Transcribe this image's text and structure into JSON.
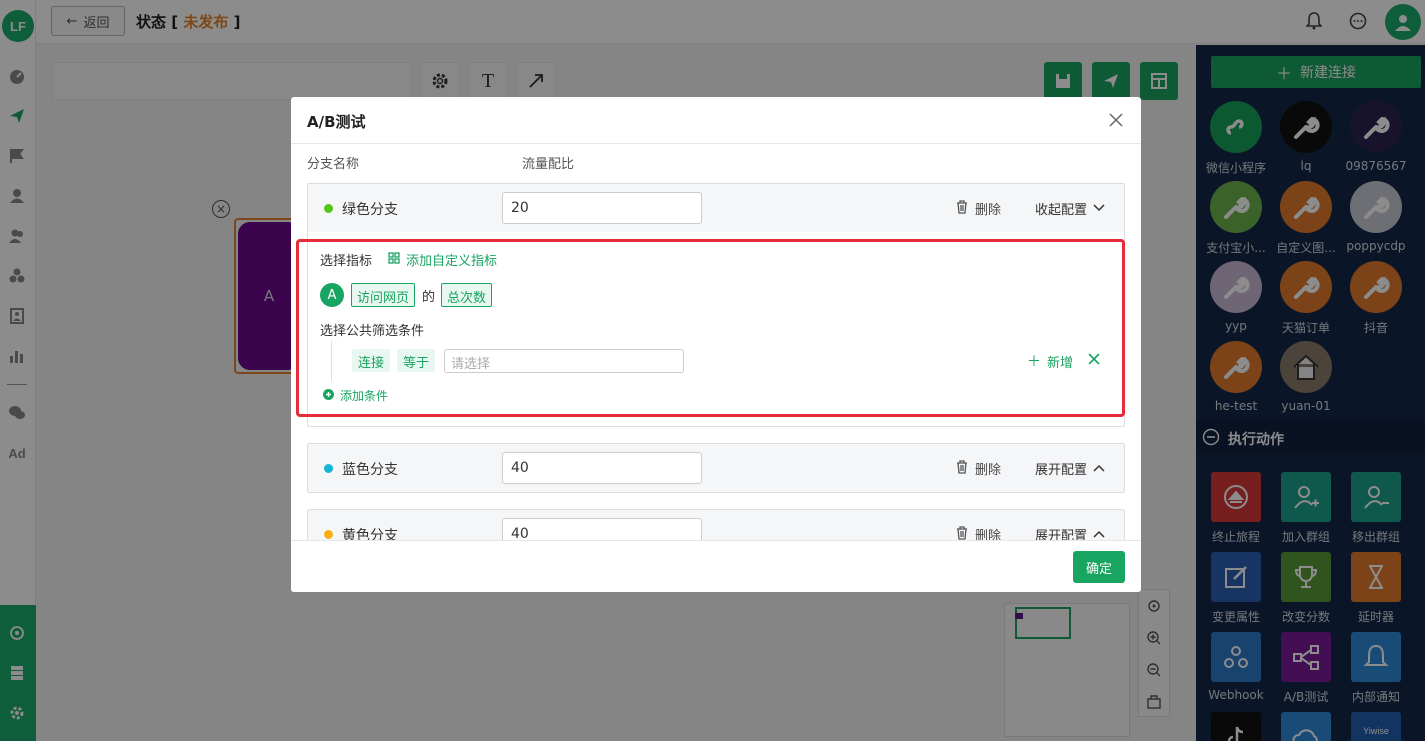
{
  "header": {
    "back_label": "返回",
    "title_prefix": "状态",
    "title_bracket_open": " [ ",
    "title_status": "未发布",
    "title_bracket_close": " ]"
  },
  "logo_text": "LF",
  "canvas": {
    "node_label": "A"
  },
  "right_panel": {
    "new_connection_label": "新建连接",
    "apps": [
      {
        "label": "微信小程序",
        "color": "#17a05a"
      },
      {
        "label": "lq",
        "color": "#111111"
      },
      {
        "label": "09876567",
        "color": "#2a2350"
      },
      {
        "label": "支付宝小...",
        "color": "#6cb34a"
      },
      {
        "label": "自定义图...",
        "color": "#e07a2a"
      },
      {
        "label": "poppycdp",
        "color": "#c9cbd6"
      },
      {
        "label": "yyp",
        "color": "#c9b8d6"
      },
      {
        "label": "天猫订单",
        "color": "#e07a2a"
      },
      {
        "label": "抖音",
        "color": "#e07a2a"
      },
      {
        "label": "he-test",
        "color": "#e07a2a"
      },
      {
        "label": "yuan-01",
        "color": "#5a4a3a"
      }
    ],
    "actions_title": "执行动作",
    "actions": [
      {
        "label": "终止旅程",
        "color": "#d9383a"
      },
      {
        "label": "加入群组",
        "color": "#1ba38a"
      },
      {
        "label": "移出群组",
        "color": "#1ba38a"
      },
      {
        "label": "变更属性",
        "color": "#2d5fb3"
      },
      {
        "label": "改变分数",
        "color": "#5a9a3a"
      },
      {
        "label": "延时器",
        "color": "#e07a2a"
      },
      {
        "label": "Webhook",
        "color": "#2d7ac9"
      },
      {
        "label": "A/B测试",
        "color": "#7a1a9a"
      },
      {
        "label": "内部通知",
        "color": "#2d8ad9"
      }
    ],
    "partial_labels": [
      "Yiwise"
    ]
  },
  "modal": {
    "title": "A/B测试",
    "col_branch_name": "分支名称",
    "col_traffic_ratio": "流量配比",
    "delete_label": "删除",
    "collapse_label": "收起配置",
    "expand_label": "展开配置",
    "branches": [
      {
        "name": "绿色分支",
        "ratio": "20",
        "color": "#52c41a"
      },
      {
        "name": "蓝色分支",
        "ratio": "40",
        "color": "#13b5d6"
      },
      {
        "name": "黄色分支",
        "ratio": "40",
        "color": "#faad14"
      }
    ],
    "config": {
      "select_metric_label": "选择指标",
      "add_custom_metric_label": "添加自定义指标",
      "metric_badge": "A",
      "metric_event": "访问网页",
      "metric_of": "的",
      "metric_measure": "总次数",
      "public_filter_label": "选择公共筛选条件",
      "filter_field": "连接",
      "filter_operator": "等于",
      "filter_placeholder": "请选择",
      "add_new_label": "新增",
      "add_condition_label": "添加条件"
    },
    "ok_label": "确定"
  }
}
